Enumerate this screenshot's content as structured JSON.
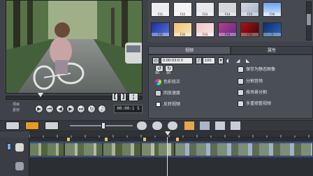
{
  "preview": {
    "mode_labels": [
      "项目",
      "素材"
    ],
    "timecode": "00:00:1 5"
  },
  "library": {
    "thumbs": [
      {
        "label": "F21"
      },
      {
        "label": "F22"
      },
      {
        "label": "F23"
      },
      {
        "label": "F24"
      },
      {
        "label": "F25"
      },
      {
        "label": "F26"
      },
      {
        "label": "F31"
      },
      {
        "label": "F32"
      },
      {
        "label": "F33"
      },
      {
        "label": "F34"
      },
      {
        "label": "F35"
      },
      {
        "label": "3"
      }
    ]
  },
  "options": {
    "tabs": [
      "视频",
      "属性"
    ],
    "duration": "0:00:03:0 0",
    "volume": "100",
    "rotate_values": [
      "90",
      "90"
    ],
    "left_items": [
      "色彩校正",
      "回放速度",
      "反转视频"
    ],
    "right_items": [
      "保存为静态图像",
      "分割音频",
      "按场景分割",
      "多重修整视频"
    ]
  },
  "timeline": {
    "track_count": 2
  },
  "colors": {
    "accent": "#3f63c9",
    "panel_bg": "#4a4f56",
    "timeline_bg": "#2b2e32",
    "scene_marker": "#e8c25a"
  }
}
